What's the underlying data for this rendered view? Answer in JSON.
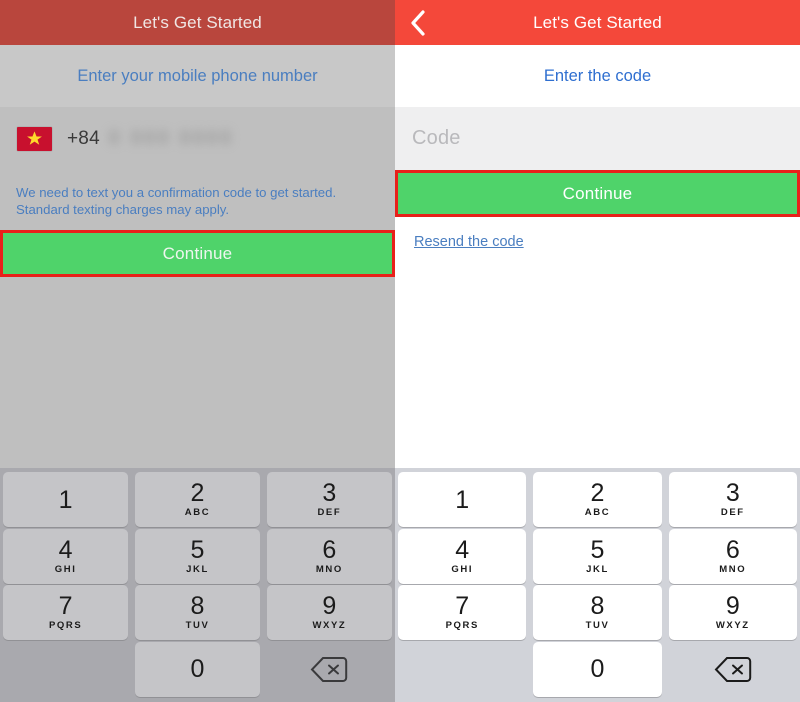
{
  "colors": {
    "navbar_active": "#f4483a",
    "navbar_dimmed": "#b9463d",
    "cta_green": "#4fd36a",
    "annotation_red": "#e8201a",
    "link_blue": "#4a7ec0",
    "panel_left_bg": "#bfbfbf",
    "panel_right_bg": "#ffffff",
    "keypad_left_bg": "#a9a9ae",
    "keypad_right_bg": "#d1d3d9",
    "flag_red": "#c8102e",
    "flag_star": "#ffd82b"
  },
  "left_panel": {
    "navbar": {
      "title": "Let's Get Started"
    },
    "prompt": "Enter your mobile phone number",
    "phone_field": {
      "flag_icon": "vietnam-flag-icon",
      "dial_code": "+84",
      "number_masked": "0 000 0000"
    },
    "helper_text": "We need to text you a confirmation code to get started. Standard texting charges may apply.",
    "cta_label": "Continue"
  },
  "right_panel": {
    "navbar": {
      "back_icon": "chevron-left-icon",
      "title": "Let's Get Started"
    },
    "prompt": "Enter the code",
    "code_field": {
      "placeholder": "Code",
      "value": ""
    },
    "cta_label": "Continue",
    "resend_label": "Resend the code"
  },
  "keypad": {
    "backspace_icon": "backspace-delete-icon",
    "rows": [
      [
        {
          "digit": "1",
          "letters": ""
        },
        {
          "digit": "2",
          "letters": "ABC"
        },
        {
          "digit": "3",
          "letters": "DEF"
        }
      ],
      [
        {
          "digit": "4",
          "letters": "GHI"
        },
        {
          "digit": "5",
          "letters": "JKL"
        },
        {
          "digit": "6",
          "letters": "MNO"
        }
      ],
      [
        {
          "digit": "7",
          "letters": "PQRS"
        },
        {
          "digit": "8",
          "letters": "TUV"
        },
        {
          "digit": "9",
          "letters": "WXYZ"
        }
      ],
      [
        {
          "digit": "",
          "letters": "",
          "spacer": true
        },
        {
          "digit": "0",
          "letters": ""
        },
        {
          "digit": "",
          "letters": "",
          "backspace": true
        }
      ]
    ]
  }
}
